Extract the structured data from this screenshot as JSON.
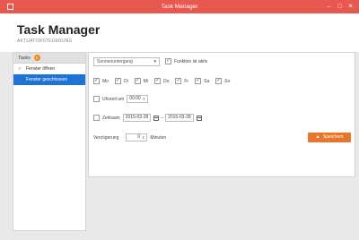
{
  "window": {
    "title": "Task Manager",
    "buttons": [
      "–",
      "□",
      "✕"
    ]
  },
  "header": {
    "app_name": "Task Manager",
    "subtitle": "AKTUATORSTEUERUNG"
  },
  "sidebar": {
    "title": "Tasks",
    "badge": "2",
    "items": [
      {
        "label": "Fenster öffnen",
        "checked": true,
        "active": false
      },
      {
        "label": "Fenster geschlossen",
        "checked": false,
        "active": true
      }
    ]
  },
  "form": {
    "trigger_select": "Sonnenuntergang",
    "active_label": "Funktion ist aktiv",
    "days": [
      "Mo",
      "Di",
      "Mi",
      "Do",
      "Fr",
      "Sa",
      "So"
    ],
    "time_label": "Uhrzeit um",
    "time_value": "00:00",
    "range_label": "Zeitraum",
    "range_from": "2015-03-28",
    "range_sep": "–",
    "range_to": "2015-03-28",
    "delay_label": "Verzögerung",
    "delay_value": "0",
    "delay_unit": "Minuten",
    "save_label": "Speichern"
  },
  "icons": {
    "save": "save-icon",
    "calendar": "calendar-icon"
  },
  "colors": {
    "titlebar": "#e8584f",
    "active_item": "#1e74d6",
    "save_button": "#e8752c",
    "badge": "#f08a24"
  }
}
